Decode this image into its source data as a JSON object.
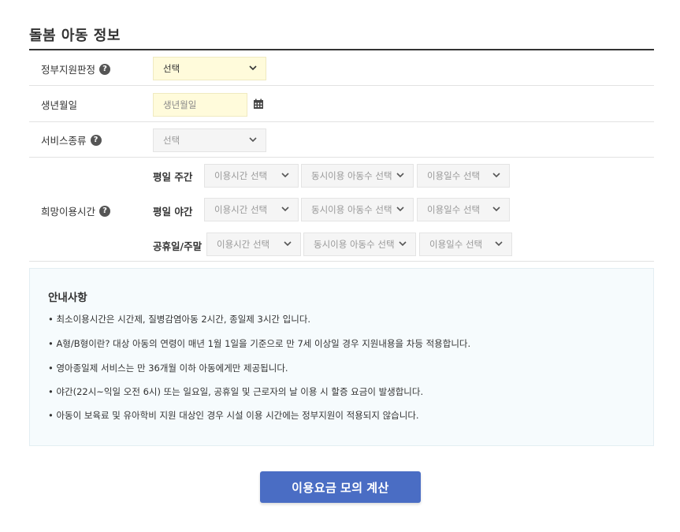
{
  "section": {
    "title": "돌봄 아동 정보"
  },
  "rows": {
    "gov_support": {
      "label": "정부지원판정",
      "select_value": "선택"
    },
    "birthdate": {
      "label": "생년월일",
      "placeholder": "생년월일"
    },
    "service_type": {
      "label": "서비스종류",
      "select_value": "선택"
    },
    "desired_time": {
      "label": "희망이용시간",
      "groups": [
        {
          "label": "평일 주간",
          "selects": [
            "이용시간 선택",
            "동시이용 아동수 선택",
            "이용일수 선택"
          ]
        },
        {
          "label": "평일 야간",
          "selects": [
            "이용시간 선택",
            "동시이용 아동수 선택",
            "이용일수 선택"
          ]
        },
        {
          "label": "공휴일/주말",
          "selects": [
            "이용시간 선택",
            "동시이용 아동수 선택",
            "이용일수 선택"
          ]
        }
      ]
    }
  },
  "notice": {
    "title": "안내사항",
    "items": [
      "• 최소이용시간은 시간제, 질병감염아동 2시간, 종일제 3시간 입니다.",
      "• A형/B형이란? 대상 아동의 연령이 매년 1월 1일을 기준으로 만 7세 이상일 경우 지원내용을 차등 적용합니다.",
      "• 영아종일제 서비스는 만 36개월 이하 아동에게만 제공됩니다.",
      "• 야간(22시~익일 오전 6시) 또는 일요일, 공휴일 및 근로자의 날 이용 시 할증 요금이 발생합니다.",
      "• 아동이 보육료 및 유아학비 지원 대상인 경우 시설 이용 시간에는 정부지원이 적용되지 않습니다."
    ]
  },
  "help_icon_glyph": "?",
  "button": {
    "label": "이용요금 모의 계산"
  },
  "icons": {
    "dropdown": "chevron-down-icon",
    "calendar": "calendar-icon",
    "help": "help-icon"
  },
  "colors": {
    "button": "#4a6dc4",
    "highlight_field": "#fffbdb",
    "notice_bg": "#f6fbfd"
  }
}
